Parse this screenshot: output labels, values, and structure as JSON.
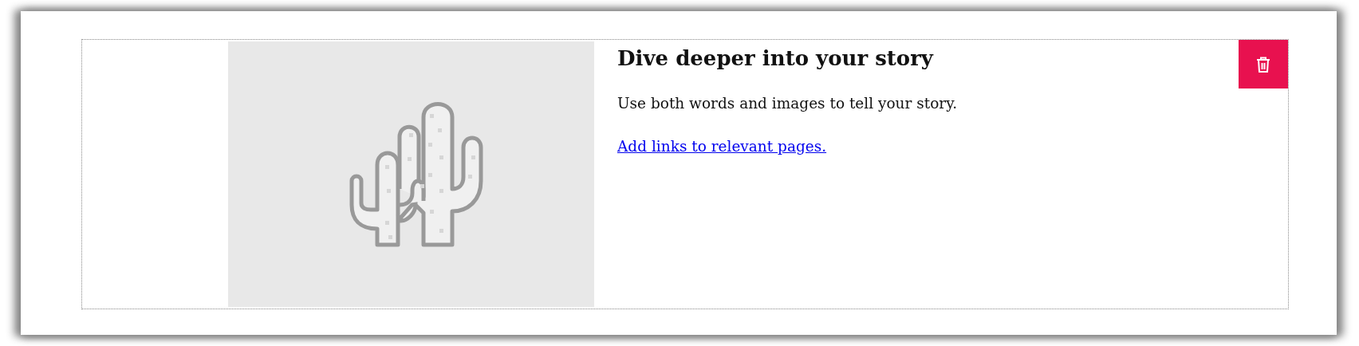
{
  "block": {
    "heading": "Dive deeper into your story",
    "body": "Use both words and images to tell your story.",
    "link": "Add links to relevant pages."
  }
}
